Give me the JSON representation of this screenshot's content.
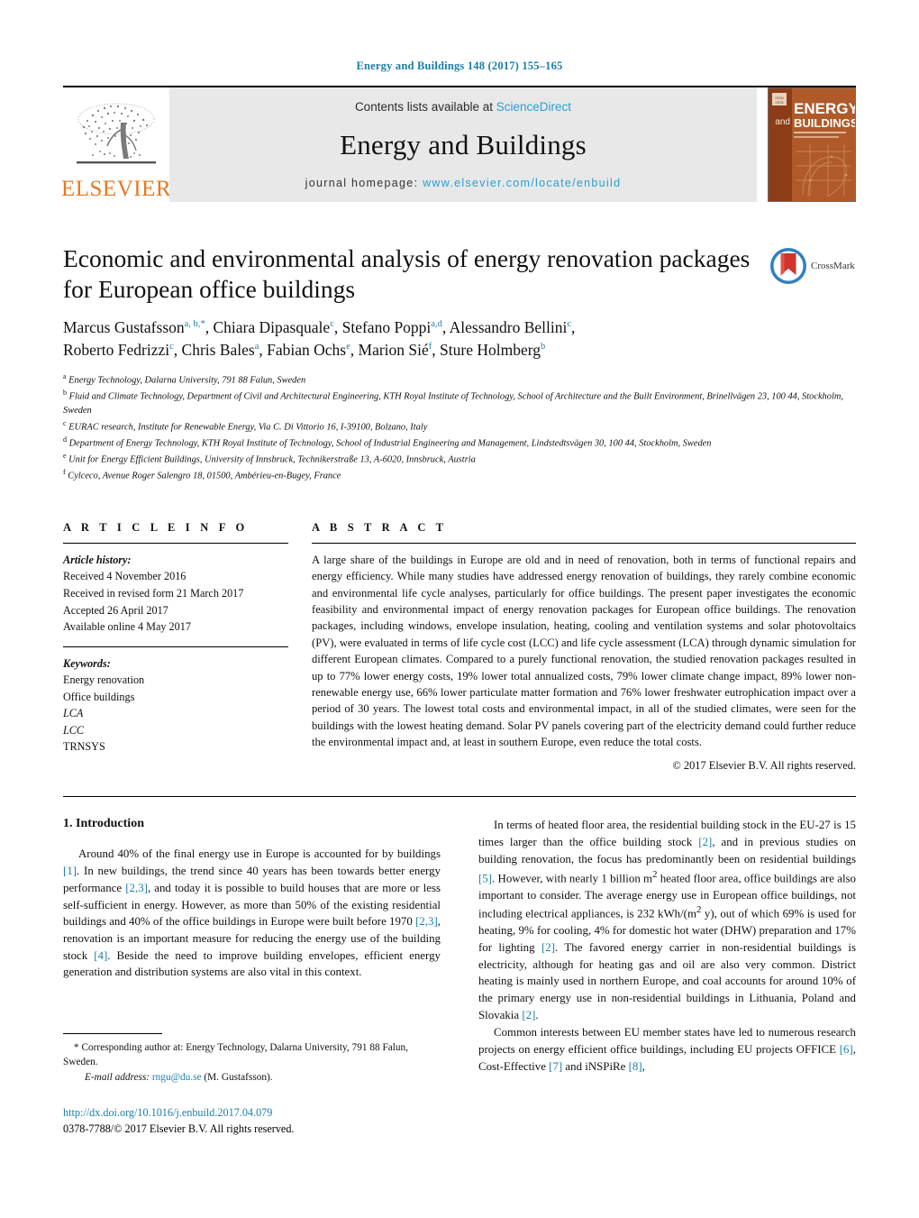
{
  "running_head": "Energy and Buildings 148 (2017) 155–165",
  "masthead": {
    "publisher_logo_label": "ELSEVIER",
    "contents_prefix": "Contents lists available at ",
    "contents_link": "ScienceDirect",
    "journal_title": "Energy and Buildings",
    "homepage_prefix": "journal homepage: ",
    "homepage_url": "www.elsevier.com/locate/enbuild",
    "cover_title_line1": "ENERGY",
    "cover_and": "and",
    "cover_title_line2": "BUILDINGS",
    "accent_link_color": "#2a9fd0",
    "elsevier_orange": "#E87722",
    "cover_orange": "#a8441e"
  },
  "crossmark": {
    "label": "CrossMark"
  },
  "article": {
    "title": "Economic and environmental analysis of energy renovation packages for European office buildings",
    "authors_line1_part1": "Marcus Gustafsson",
    "authors_line1_mark1": "a, b,",
    "authors_line1_star": "*",
    "authors_line1_part2": ", Chiara Dipasquale",
    "authors_line1_mark2": "c",
    "authors_line1_part3": ", Stefano Poppi",
    "authors_line1_mark3": "a,d",
    "authors_line1_part4": ", Alessandro Bellini",
    "authors_line1_mark4": "c",
    "authors_line1_end": ",",
    "authors_line2_part1": "Roberto Fedrizzi",
    "authors_line2_mark1": "c",
    "authors_line2_part2": ", Chris Bales",
    "authors_line2_mark2": "a",
    "authors_line2_part3": ", Fabian Ochs",
    "authors_line2_mark3": "e",
    "authors_line2_part4": ", Marion Sié",
    "authors_line2_mark4": "f",
    "authors_line2_part5": ", Sture Holmberg",
    "authors_line2_mark5": "b",
    "affiliations": [
      {
        "mark": "a",
        "text": "Energy Technology, Dalarna University, 791 88 Falun, Sweden"
      },
      {
        "mark": "b",
        "text": "Fluid and Climate Technology, Department of Civil and Architectural Engineering, KTH Royal Institute of Technology, School of Architecture and the Built Environment, Brinellvägen 23, 100 44, Stockholm, Sweden"
      },
      {
        "mark": "c",
        "text": "EURAC research, Institute for Renewable Energy, Via C. Di Vittorio 16, I-39100, Bolzano, Italy"
      },
      {
        "mark": "d",
        "text": "Department of Energy Technology, KTH Royal Institute of Technology, School of Industrial Engineering and Management, Lindstedtsvägen 30, 100 44, Stockholm, Sweden"
      },
      {
        "mark": "e",
        "text": "Unit for Energy Efficient Buildings, University of Innsbruck, Technikerstraße 13, A-6020, Innsbruck, Austria"
      },
      {
        "mark": "f",
        "text": "Cylceco, Avenue Roger Salengro 18, 01500, Ambérieu-en-Bugey, France"
      }
    ]
  },
  "article_info": {
    "heading": "A R T I C L E   I N F O",
    "history_label": "Article history:",
    "history": [
      "Received 4 November 2016",
      "Received in revised form 21 March 2017",
      "Accepted 26 April 2017",
      "Available online 4 May 2017"
    ],
    "keywords_label": "Keywords:",
    "keywords": [
      "Energy renovation",
      "Office buildings",
      "LCA",
      "LCC",
      "TRNSYS"
    ]
  },
  "abstract": {
    "heading": "A B S T R A C T",
    "text": "A large share of the buildings in Europe are old and in need of renovation, both in terms of functional repairs and energy efficiency. While many studies have addressed energy renovation of buildings, they rarely combine economic and environmental life cycle analyses, particularly for office buildings. The present paper investigates the economic feasibility and environmental impact of energy renovation packages for European office buildings. The renovation packages, including windows, envelope insulation, heating, cooling and ventilation systems and solar photovoltaics (PV), were evaluated in terms of life cycle cost (LCC) and life cycle assessment (LCA) through dynamic simulation for different European climates. Compared to a purely functional renovation, the studied renovation packages resulted in up to 77% lower energy costs, 19% lower total annualized costs, 79% lower climate change impact, 89% lower non-renewable energy use, 66% lower particulate matter formation and 76% lower freshwater eutrophication impact over a period of 30 years. The lowest total costs and environmental impact, in all of the studied climates, were seen for the buildings with the lowest heating demand. Solar PV panels covering part of the electricity demand could further reduce the environmental impact and, at least in southern Europe, even reduce the total costs.",
    "copyright": "© 2017 Elsevier B.V. All rights reserved."
  },
  "introduction": {
    "heading": "1.  Introduction",
    "left_paragraph_1": {
      "t1": "Around 40% of the final energy use in Europe is accounted for by buildings ",
      "r1": "[1]",
      "t2": ". In new buildings, the trend since 40 years has been towards better energy performance ",
      "r2": "[2,3]",
      "t3": ", and today it is possible to build houses that are more or less self-sufficient in energy. However, as more than 50% of the existing residential buildings and 40% of the office buildings in Europe were built before 1970 ",
      "r3": "[2,3]",
      "t4": ", renovation is an important measure for reducing the energy use of the building stock ",
      "r4": "[4]",
      "t5": ". Beside the need to improve building envelopes, efficient energy generation and distribution systems are also vital in this context."
    },
    "right_paragraph_1": {
      "t1": "In terms of heated floor area, the residential building stock in the EU-27 is 15 times larger than the office building stock ",
      "r1": "[2]",
      "t2": ", and in previous studies on building renovation, the focus has predominantly been on residential buildings ",
      "r2": "[5]",
      "t3": ". However, with nearly 1 billion m",
      "sup1": "2",
      "t4": " heated floor area, office buildings are also important to consider. The average energy use in European office buildings, not including electrical appliances, is 232 kWh/(m",
      "sup2": "2",
      "t5": " y), out of which 69% is used for heating, 9% for cooling, 4% for domestic hot water (DHW) preparation and 17% for lighting ",
      "r3": "[2]",
      "t6": ". The favored energy carrier in non-residential buildings is electricity, although for heating gas and oil are also very common. District heating is mainly used in northern Europe, and coal accounts for around 10% of the primary energy use in non-residential buildings in Lithuania, Poland and Slovakia ",
      "r4": "[2]",
      "t7": "."
    },
    "right_paragraph_2": {
      "t1": "Common interests between EU member states have led to numerous research projects on energy efficient office buildings, including EU projects OFFICE ",
      "r1": "[6]",
      "t2": ", Cost-Effective ",
      "r2": "[7]",
      "t3": " and iNSPiRe ",
      "r3": "[8]",
      "t4": ","
    }
  },
  "footnote": {
    "star": "*",
    "corresponding": " Corresponding author at: Energy Technology, Dalarna University, 791 88 Falun, Sweden.",
    "email_label": "E-mail address:",
    "email": "rngu@du.se",
    "email_owner": "(M. Gustafsson).",
    "doi_url": "http://dx.doi.org/10.1016/j.enbuild.2017.04.079",
    "issn_line": "0378-7788/© 2017 Elsevier B.V. All rights reserved."
  }
}
